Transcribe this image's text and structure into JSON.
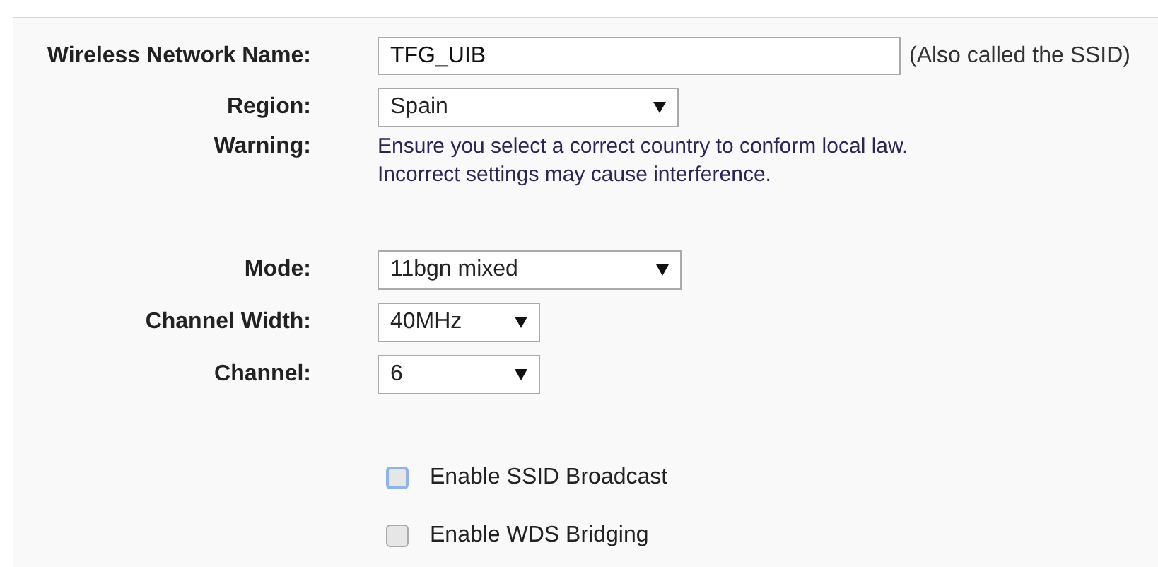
{
  "sections": [
    {
      "rows": [
        {
          "kind": "text",
          "label": "Wireless Network Name:",
          "value": "TFG_UIB",
          "hint": "(Also called the SSID)"
        },
        {
          "kind": "select",
          "label": "Region:",
          "value": "Spain"
        },
        {
          "kind": "note",
          "label": "Warning:",
          "lines": [
            "Ensure you select a correct country to conform local law.",
            "Incorrect settings may cause interference."
          ]
        }
      ]
    },
    {
      "rows": [
        {
          "kind": "select",
          "label": "Mode:",
          "value": "11bgn mixed"
        },
        {
          "kind": "select",
          "label": "Channel Width:",
          "value": "40MHz"
        },
        {
          "kind": "select",
          "label": "Channel:",
          "value": "6"
        }
      ]
    },
    {
      "rows": [
        {
          "kind": "checkbox",
          "label": "Enable SSID Broadcast",
          "checked": false,
          "focused": true
        },
        {
          "kind": "checkbox",
          "label": "Enable WDS Bridging",
          "checked": false,
          "focused": false
        }
      ]
    }
  ]
}
